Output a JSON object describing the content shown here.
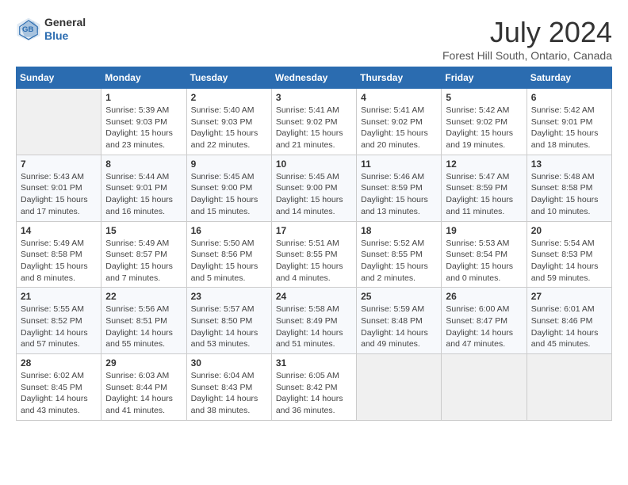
{
  "header": {
    "logo_general": "General",
    "logo_blue": "Blue",
    "title": "July 2024",
    "location": "Forest Hill South, Ontario, Canada"
  },
  "days_of_week": [
    "Sunday",
    "Monday",
    "Tuesday",
    "Wednesday",
    "Thursday",
    "Friday",
    "Saturday"
  ],
  "weeks": [
    [
      {
        "day": "",
        "info": ""
      },
      {
        "day": "1",
        "info": "Sunrise: 5:39 AM\nSunset: 9:03 PM\nDaylight: 15 hours\nand 23 minutes."
      },
      {
        "day": "2",
        "info": "Sunrise: 5:40 AM\nSunset: 9:03 PM\nDaylight: 15 hours\nand 22 minutes."
      },
      {
        "day": "3",
        "info": "Sunrise: 5:41 AM\nSunset: 9:02 PM\nDaylight: 15 hours\nand 21 minutes."
      },
      {
        "day": "4",
        "info": "Sunrise: 5:41 AM\nSunset: 9:02 PM\nDaylight: 15 hours\nand 20 minutes."
      },
      {
        "day": "5",
        "info": "Sunrise: 5:42 AM\nSunset: 9:02 PM\nDaylight: 15 hours\nand 19 minutes."
      },
      {
        "day": "6",
        "info": "Sunrise: 5:42 AM\nSunset: 9:01 PM\nDaylight: 15 hours\nand 18 minutes."
      }
    ],
    [
      {
        "day": "7",
        "info": "Sunrise: 5:43 AM\nSunset: 9:01 PM\nDaylight: 15 hours\nand 17 minutes."
      },
      {
        "day": "8",
        "info": "Sunrise: 5:44 AM\nSunset: 9:01 PM\nDaylight: 15 hours\nand 16 minutes."
      },
      {
        "day": "9",
        "info": "Sunrise: 5:45 AM\nSunset: 9:00 PM\nDaylight: 15 hours\nand 15 minutes."
      },
      {
        "day": "10",
        "info": "Sunrise: 5:45 AM\nSunset: 9:00 PM\nDaylight: 15 hours\nand 14 minutes."
      },
      {
        "day": "11",
        "info": "Sunrise: 5:46 AM\nSunset: 8:59 PM\nDaylight: 15 hours\nand 13 minutes."
      },
      {
        "day": "12",
        "info": "Sunrise: 5:47 AM\nSunset: 8:59 PM\nDaylight: 15 hours\nand 11 minutes."
      },
      {
        "day": "13",
        "info": "Sunrise: 5:48 AM\nSunset: 8:58 PM\nDaylight: 15 hours\nand 10 minutes."
      }
    ],
    [
      {
        "day": "14",
        "info": "Sunrise: 5:49 AM\nSunset: 8:58 PM\nDaylight: 15 hours\nand 8 minutes."
      },
      {
        "day": "15",
        "info": "Sunrise: 5:49 AM\nSunset: 8:57 PM\nDaylight: 15 hours\nand 7 minutes."
      },
      {
        "day": "16",
        "info": "Sunrise: 5:50 AM\nSunset: 8:56 PM\nDaylight: 15 hours\nand 5 minutes."
      },
      {
        "day": "17",
        "info": "Sunrise: 5:51 AM\nSunset: 8:55 PM\nDaylight: 15 hours\nand 4 minutes."
      },
      {
        "day": "18",
        "info": "Sunrise: 5:52 AM\nSunset: 8:55 PM\nDaylight: 15 hours\nand 2 minutes."
      },
      {
        "day": "19",
        "info": "Sunrise: 5:53 AM\nSunset: 8:54 PM\nDaylight: 15 hours\nand 0 minutes."
      },
      {
        "day": "20",
        "info": "Sunrise: 5:54 AM\nSunset: 8:53 PM\nDaylight: 14 hours\nand 59 minutes."
      }
    ],
    [
      {
        "day": "21",
        "info": "Sunrise: 5:55 AM\nSunset: 8:52 PM\nDaylight: 14 hours\nand 57 minutes."
      },
      {
        "day": "22",
        "info": "Sunrise: 5:56 AM\nSunset: 8:51 PM\nDaylight: 14 hours\nand 55 minutes."
      },
      {
        "day": "23",
        "info": "Sunrise: 5:57 AM\nSunset: 8:50 PM\nDaylight: 14 hours\nand 53 minutes."
      },
      {
        "day": "24",
        "info": "Sunrise: 5:58 AM\nSunset: 8:49 PM\nDaylight: 14 hours\nand 51 minutes."
      },
      {
        "day": "25",
        "info": "Sunrise: 5:59 AM\nSunset: 8:48 PM\nDaylight: 14 hours\nand 49 minutes."
      },
      {
        "day": "26",
        "info": "Sunrise: 6:00 AM\nSunset: 8:47 PM\nDaylight: 14 hours\nand 47 minutes."
      },
      {
        "day": "27",
        "info": "Sunrise: 6:01 AM\nSunset: 8:46 PM\nDaylight: 14 hours\nand 45 minutes."
      }
    ],
    [
      {
        "day": "28",
        "info": "Sunrise: 6:02 AM\nSunset: 8:45 PM\nDaylight: 14 hours\nand 43 minutes."
      },
      {
        "day": "29",
        "info": "Sunrise: 6:03 AM\nSunset: 8:44 PM\nDaylight: 14 hours\nand 41 minutes."
      },
      {
        "day": "30",
        "info": "Sunrise: 6:04 AM\nSunset: 8:43 PM\nDaylight: 14 hours\nand 38 minutes."
      },
      {
        "day": "31",
        "info": "Sunrise: 6:05 AM\nSunset: 8:42 PM\nDaylight: 14 hours\nand 36 minutes."
      },
      {
        "day": "",
        "info": ""
      },
      {
        "day": "",
        "info": ""
      },
      {
        "day": "",
        "info": ""
      }
    ]
  ]
}
